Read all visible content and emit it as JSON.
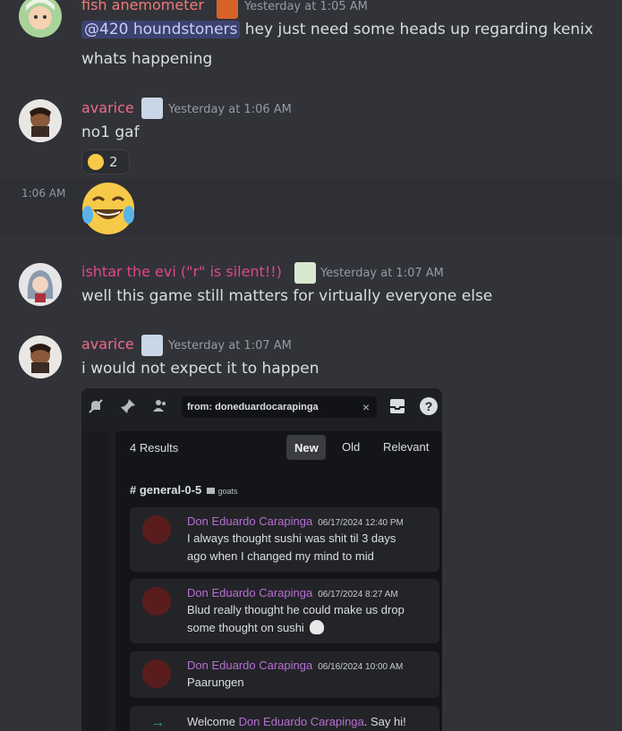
{
  "messages": [
    {
      "author": "fish anemometer",
      "author_color": "#f27a7a",
      "timestamp": "Yesterday at 1:05 AM",
      "mention": "@420 houndstoners",
      "text1": "hey just need some heads up regarding kenix",
      "text2": "whats happening"
    },
    {
      "author": "avarice",
      "author_color": "#f06a8c",
      "timestamp": "Yesterday at 1:06 AM",
      "text": "no1 gaf",
      "reaction_count": "2",
      "followup_time": "1:06 AM"
    },
    {
      "author": "ishtar the evi (\"r\" is silent!!)",
      "author_color": "#e0488a",
      "timestamp": "Yesterday at 1:07 AM",
      "text": "well this game still matters for virtually everyone else"
    },
    {
      "author": "avarice",
      "author_color": "#f06a8c",
      "timestamp": "Yesterday at 1:07 AM",
      "text": "i would not expect it to happen"
    }
  ],
  "screenshot": {
    "search_query": "from: doneduardocarapinga",
    "results_count": "4 Results",
    "tabs": [
      "New",
      "Old",
      "Relevant"
    ],
    "channel": "# general-0-5",
    "category": "goats",
    "results": [
      {
        "author": "Don Eduardo Carapinga",
        "date": "06/17/2024 12:40 PM",
        "line1": "I always thought sushi was shit til 3 days",
        "line2": "ago when I changed my mind to mid"
      },
      {
        "author": "Don Eduardo Carapinga",
        "date": "06/17/2024 8:27 AM",
        "line1": "Blud really thought he could make us drop",
        "line2": "some thought on sushi"
      },
      {
        "author": "Don Eduardo Carapinga",
        "date": "06/16/2024 10:00 AM",
        "line1": "Paarungen",
        "line2": ""
      }
    ],
    "welcome_prefix": "Welcome ",
    "welcome_name": "Don Eduardo Carapinga",
    "welcome_suffix": ". Say hi!"
  }
}
